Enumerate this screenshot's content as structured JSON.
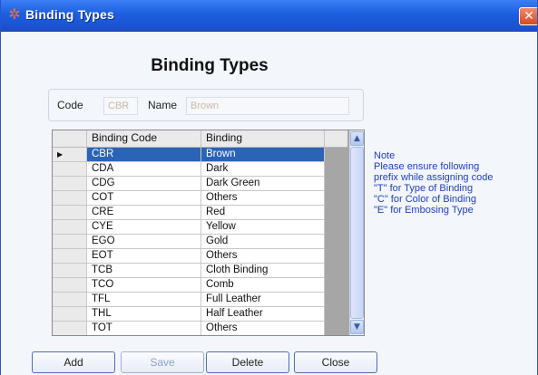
{
  "window": {
    "title": "Binding Types",
    "title_icon": "gear-star-icon",
    "close_glyph": "✕"
  },
  "heading": "Binding Types",
  "form": {
    "code_label": "Code",
    "code_value": "CBR",
    "name_label": "Name",
    "name_value": "Brown"
  },
  "grid": {
    "columns": [
      "Binding Code",
      "Binding"
    ],
    "row_indicator": "▶",
    "selected_index": 0,
    "rows": [
      {
        "code": "CBR",
        "binding": "Brown"
      },
      {
        "code": "CDA",
        "binding": "Dark"
      },
      {
        "code": "CDG",
        "binding": "Dark Green"
      },
      {
        "code": "COT",
        "binding": "Others"
      },
      {
        "code": "CRE",
        "binding": "Red"
      },
      {
        "code": "CYE",
        "binding": "Yellow"
      },
      {
        "code": "EGO",
        "binding": "Gold"
      },
      {
        "code": "EOT",
        "binding": "Others"
      },
      {
        "code": "TCB",
        "binding": "Cloth Binding"
      },
      {
        "code": "TCO",
        "binding": "Comb"
      },
      {
        "code": "TFL",
        "binding": "Full Leather"
      },
      {
        "code": "THL",
        "binding": "Half Leather"
      },
      {
        "code": "TOT",
        "binding": "Others"
      }
    ],
    "scroll_up_glyph": "▲",
    "scroll_down_glyph": "▼"
  },
  "note": {
    "lines": [
      "Note",
      "Please ensure following",
      "prefix while assigning code",
      "\"T\" for Type of Binding",
      "\"C\" for Color of Binding",
      "\"E\" for Embosing Type"
    ]
  },
  "buttons": {
    "add": "Add",
    "save": "Save",
    "delete": "Delete",
    "close": "Close"
  },
  "colors": {
    "titlebar": "#1d5fe0",
    "selection": "#2b63b6",
    "note_text": "#1f3fbf"
  }
}
